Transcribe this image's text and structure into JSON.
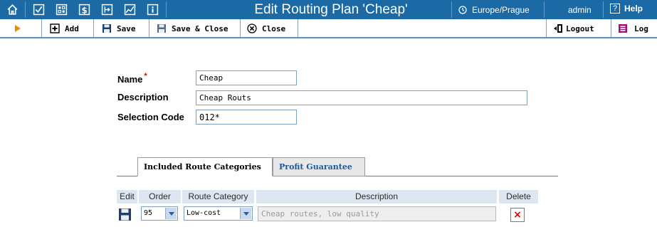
{
  "header": {
    "title": "Edit Routing Plan 'Cheap'",
    "timezone": "Europe/Prague",
    "user": "admin",
    "help_label": "Help",
    "help_icon_text": "?",
    "icons": [
      "home-icon",
      "checkbox-icon",
      "grid-icon",
      "dollar-icon",
      "export-icon",
      "chart-icon",
      "info-icon",
      "clock-icon"
    ]
  },
  "toolbar": {
    "add_label": "Add",
    "save_label": "Save",
    "save_close_label": "Save & Close",
    "close_label": "Close",
    "logout_label": "Logout",
    "log_label": "Log"
  },
  "form": {
    "name_label": "Name",
    "required_mark": "*",
    "name_value": "Cheap",
    "description_label": "Description",
    "description_value": "Cheap Routs",
    "selection_code_label": "Selection Code",
    "selection_code_value": "012*"
  },
  "tabs": [
    {
      "label": "Included Route Categories",
      "active": true
    },
    {
      "label": "Profit Guarantee",
      "active": false
    }
  ],
  "grid": {
    "columns": [
      "Edit",
      "Order",
      "Route Category",
      "Description",
      "Delete"
    ],
    "rows": [
      {
        "order": "95",
        "route_category": "Low-cost",
        "description_placeholder": "Cheap routes, low quality",
        "delete_glyph": "×"
      }
    ]
  },
  "colors": {
    "header_bg": "#1b6aa5",
    "accent_orange": "#f08a00",
    "delete_red": "#e00000",
    "grid_header_bg": "#dde7f1"
  }
}
